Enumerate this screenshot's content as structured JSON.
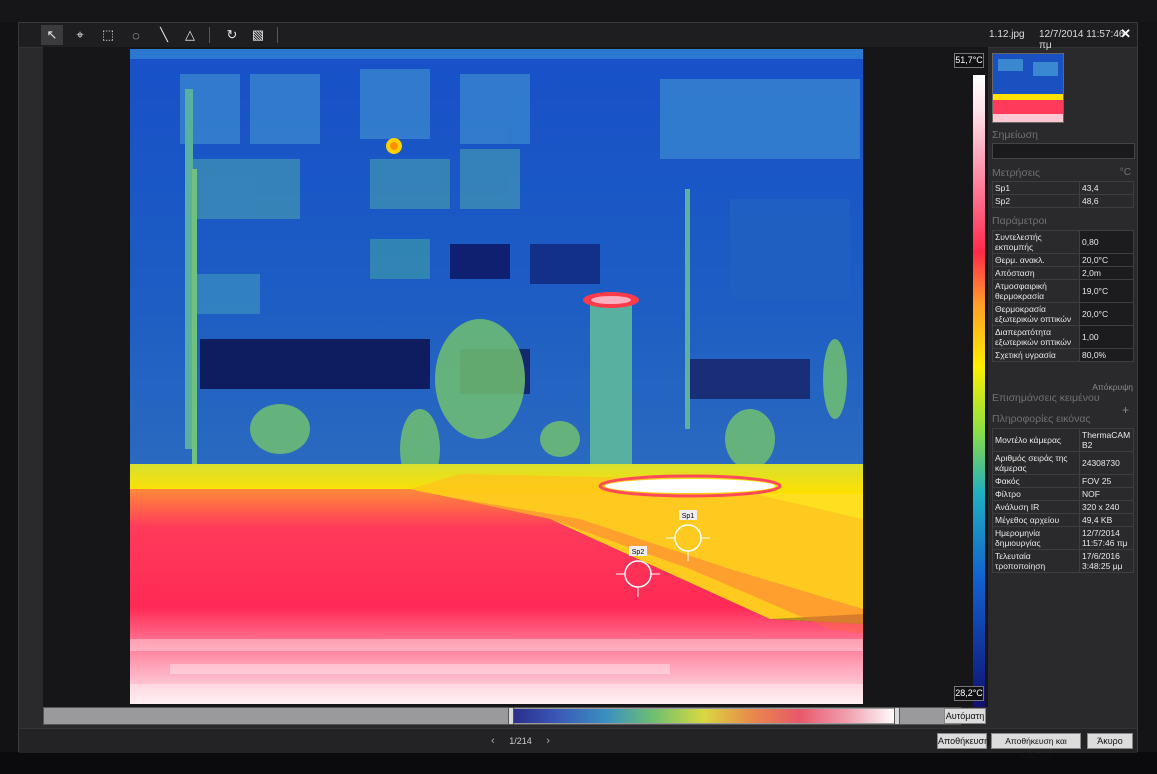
{
  "toolbar": {
    "filename": "1.12.jpg",
    "datetime": "12/7/2014 11:57:46 πμ"
  },
  "scale": {
    "max": "51,7°C",
    "min": "28,2°C"
  },
  "sections": {
    "note": "Σημείωση",
    "measurements": "Μετρήσεις",
    "measurements_unit": "°C",
    "parameters": "Παράμετροι",
    "hide": "Απόκρυψη",
    "text_annotations": "Επισημάνσεις κειμένου",
    "image_info": "Πληροφορίες εικόνας"
  },
  "measurements": [
    {
      "name": "Sp1",
      "value": "43,4"
    },
    {
      "name": "Sp2",
      "value": "48,6"
    }
  ],
  "parameters": [
    {
      "name": "Συντελεστής εκπομπής",
      "value": "0,80"
    },
    {
      "name": "Θερμ. ανακλ.",
      "value": "20,0°C"
    },
    {
      "name": "Απόσταση",
      "value": "2,0m"
    },
    {
      "name": "Ατμοσφαιρική θερμοκρασία",
      "value": "19,0°C"
    },
    {
      "name": "Θερμοκρασία εξωτερικών οπτικών",
      "value": "20,0°C"
    },
    {
      "name": "Διαπερατότητα εξωτερικών οπτικών",
      "value": "1,00"
    },
    {
      "name": "Σχετική υγρασία",
      "value": "80,0%"
    }
  ],
  "image_info": [
    {
      "name": "Μοντέλο κάμερας",
      "value": "ThermaCAM B2"
    },
    {
      "name": "Αριθμός σειράς της κάμερας",
      "value": "24308730"
    },
    {
      "name": "Φακός",
      "value": "FOV 25"
    },
    {
      "name": "Φίλτρο",
      "value": "NOF"
    },
    {
      "name": "Ανάλυση IR",
      "value": "320 x 240"
    },
    {
      "name": "Μέγεθος αρχείου",
      "value": "49,4 KB"
    },
    {
      "name": "Ημερομηνία δημιουργίας",
      "value": "12/7/2014 11:57:46 πμ"
    },
    {
      "name": "Τελευταία τροποποίηση",
      "value": "17/6/2016 3:48:25 μμ"
    }
  ],
  "spots": [
    {
      "label": "Sp1"
    },
    {
      "label": "Sp2"
    }
  ],
  "buttons": {
    "auto": "Αυτόματη",
    "save": "Αποθήκευση",
    "save_close": "Αποθήκευση και κλείσιμο",
    "cancel": "Άκυρο"
  },
  "pager": {
    "text": "1/214"
  }
}
